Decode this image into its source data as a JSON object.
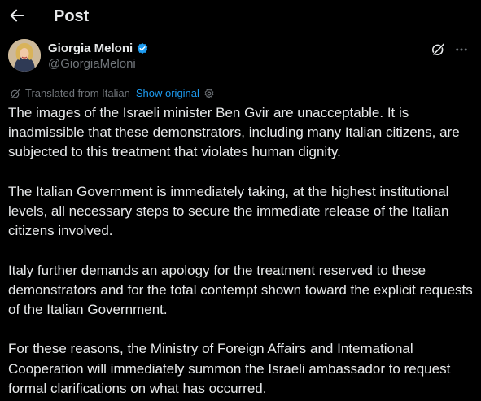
{
  "header": {
    "title": "Post"
  },
  "author": {
    "name": "Giorgia Meloni",
    "handle": "@GiorgiaMeloni",
    "verified_color": "#1d9bf0"
  },
  "translation": {
    "label": "Translated from Italian",
    "show_original": "Show original"
  },
  "post": {
    "paragraphs": [
      "The images of the Israeli minister Ben Gvir are unacceptable. It is inadmissible that these demonstrators, including many Italian citizens, are subjected to this treatment that violates human dignity.",
      "The Italian Government is immediately taking, at the highest institutional levels, all necessary steps to secure the immediate release of the Italian citizens involved.",
      "Italy further demands an apology for the treatment reserved to these demonstrators and for the total contempt shown toward the explicit requests of the Italian Government.",
      "For these reasons, the Ministry of Foreign Affairs and International Cooperation will immediately summon the Israeli ambassador to request formal clarifications on what has occurred."
    ]
  },
  "icons": {
    "back": "arrow-left-icon",
    "verified": "verified-badge-icon",
    "grok": "grok-icon",
    "more": "more-icon",
    "translate": "translate-icon",
    "settings": "gear-icon"
  },
  "colors": {
    "background": "#000000",
    "text": "#e7e9ea",
    "secondary": "#71767b",
    "accent": "#1d9bf0"
  }
}
